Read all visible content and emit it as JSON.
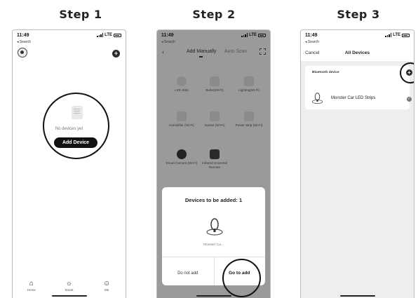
{
  "steps": [
    {
      "title": "Step 1"
    },
    {
      "title": "Step 2"
    },
    {
      "title": "Step 3"
    }
  ],
  "status": {
    "time": "11:49",
    "network": "LTE",
    "back": "◂ Search"
  },
  "step1": {
    "empty_text": "No devices yet",
    "add_button": "Add Device",
    "tabs": [
      {
        "icon": "home-icon",
        "label": "Home"
      },
      {
        "icon": "sun-icon",
        "label": "Smart"
      },
      {
        "icon": "smile-icon",
        "label": "Me"
      }
    ]
  },
  "step2": {
    "tabs": [
      {
        "label": "Add Manually"
      },
      {
        "label": "Auto Scan"
      }
    ],
    "categories": [
      {
        "label": "LED Strip"
      },
      {
        "label": "Bulbs(Wi-Fi)"
      },
      {
        "label": "Lighting(Wi-Fi)"
      },
      {
        "label": "Humidifier (Wi-Fi)"
      },
      {
        "label": "Socket (Wi-Fi)"
      },
      {
        "label": "Power Strip (Wi-Fi)"
      },
      {
        "label": "Smart Camera (Wi-Fi)"
      },
      {
        "label": "Infrared Universal Remote"
      }
    ],
    "sheet": {
      "title": "Devices to be added: 1",
      "device": "Monster Ca...",
      "cancel": "Do not add",
      "confirm": "Go to add"
    }
  },
  "step3": {
    "cancel": "Cancel",
    "title": "All Devices",
    "section": "Bluetooth device",
    "device": "Monster Car LED Strips"
  }
}
